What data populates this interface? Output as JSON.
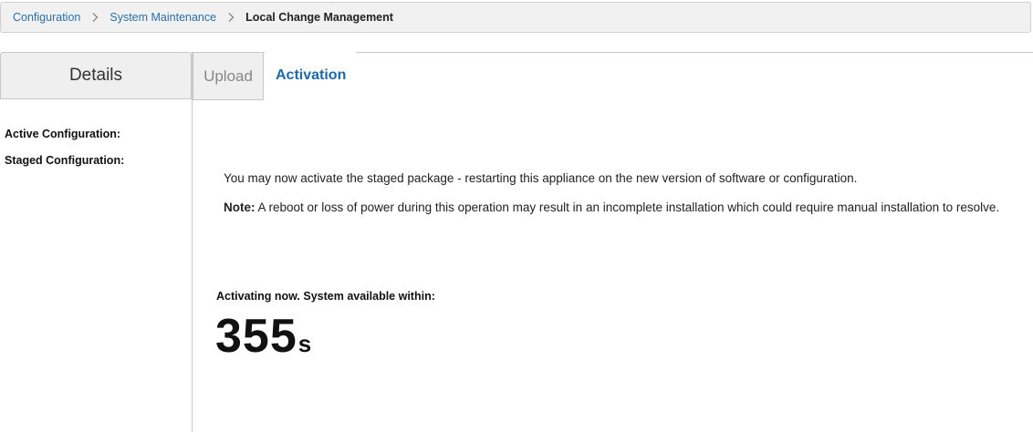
{
  "breadcrumb": {
    "items": [
      "Configuration",
      "System Maintenance"
    ],
    "current": "Local Change Management"
  },
  "left": {
    "tab_label": "Details",
    "active_configuration_label": "Active Configuration:",
    "staged_configuration_label": "Staged Configuration:"
  },
  "tabs": {
    "upload_label": "Upload",
    "activation_label": "Activation"
  },
  "main": {
    "message": "You may now activate the staged package - restarting this appliance on the new version of software or configuration.",
    "note_prefix": "Note:",
    "note_text": " A reboot or loss of power during this operation may result in an incomplete installation which could require manual installation to resolve.",
    "status_label": "Activating now. System available within:",
    "countdown_value": "355",
    "countdown_unit": "s"
  },
  "colors": {
    "link": "#2a6fa8",
    "active_tab": "#1d6aa8",
    "panel_bg": "#efefef"
  },
  "icons": {
    "breadcrumb_separator": "chevron-right-icon"
  }
}
